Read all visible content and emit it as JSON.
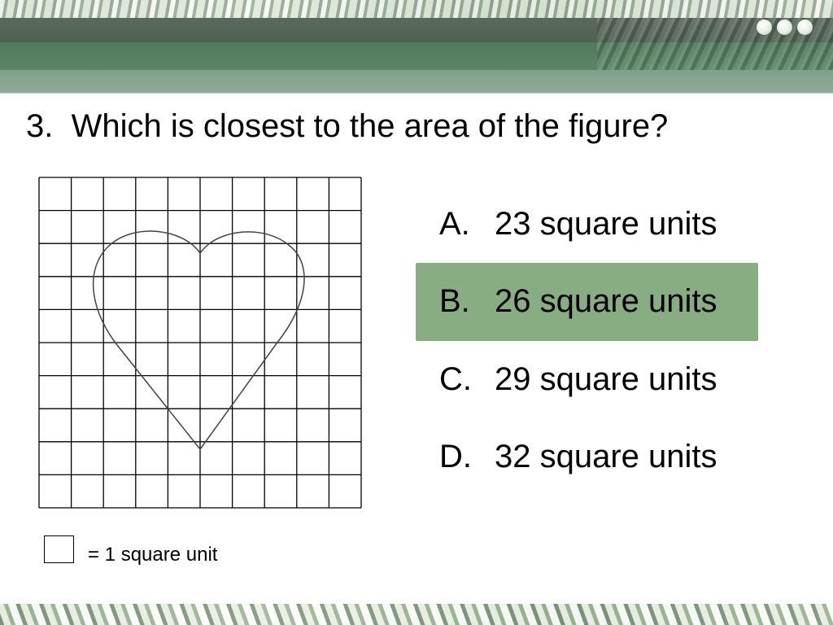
{
  "question": {
    "number": "3.",
    "text": "Which is closest to the area of the figure?"
  },
  "figure": {
    "grid_columns": 10,
    "grid_rows": 10,
    "shape": "heart"
  },
  "legend": {
    "text": "= 1 square unit"
  },
  "answers": [
    {
      "letter": "A.",
      "text": "23 square units",
      "selected": false
    },
    {
      "letter": "B.",
      "text": "26 square units",
      "selected": true
    },
    {
      "letter": "C.",
      "text": "29 square units",
      "selected": false
    },
    {
      "letter": "D.",
      "text": "32 square units",
      "selected": false
    }
  ],
  "colors": {
    "highlight": "#88ad83",
    "header_dark": "#4f6152",
    "header_green": "#5c8667",
    "header_light": "#7fa18a",
    "grid_line": "#000000",
    "heart_stroke": "#444444"
  },
  "icons": {
    "header_dots": [
      "circle-icon",
      "circle-icon",
      "circle-icon"
    ]
  }
}
